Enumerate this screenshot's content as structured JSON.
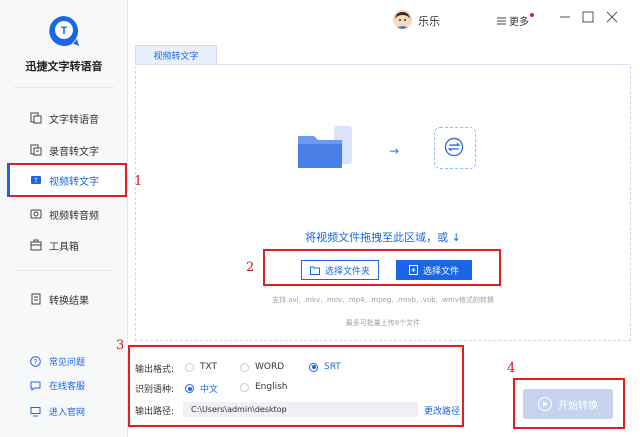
{
  "app": {
    "name": "迅捷文字转语音",
    "logo_letter": "T"
  },
  "sidebar": {
    "items": [
      {
        "label": "文字转语音",
        "icon": "text-to-speech-icon"
      },
      {
        "label": "录音转文字",
        "icon": "recording-to-text-icon"
      },
      {
        "label": "视频转文字",
        "icon": "video-to-text-icon",
        "active": true
      },
      {
        "label": "视频转音频",
        "icon": "video-to-audio-icon"
      },
      {
        "label": "工具箱",
        "icon": "toolbox-icon"
      },
      {
        "label": "转换结果",
        "icon": "results-icon"
      }
    ],
    "bottom_links": [
      {
        "label": "常见问题",
        "icon": "question-icon"
      },
      {
        "label": "在线客服",
        "icon": "chat-icon"
      },
      {
        "label": "进入官网",
        "icon": "monitor-icon"
      }
    ]
  },
  "header": {
    "user_name": "乐乐",
    "more_label": "更多"
  },
  "tab": {
    "label": "视频转文字"
  },
  "drop_area": {
    "hint": "将视频文件拖拽至此区域，或 ↓",
    "select_folder_label": "选择文件夹",
    "select_file_label": "选择文件",
    "supported_formats": "支持.avi, .mkv, .mov, .mp4, .mpeg, .rmvb, .vob, .wmv格式的转换",
    "max_files": "最多可批量上传8个文件"
  },
  "options": {
    "output_format_label": "输出格式:",
    "formats": [
      {
        "label": "TXT",
        "selected": false
      },
      {
        "label": "WORD",
        "selected": false
      },
      {
        "label": "SRT",
        "selected": true
      }
    ],
    "language_label": "识别语种:",
    "languages": [
      {
        "label": "中文",
        "selected": true
      },
      {
        "label": "English",
        "selected": false
      }
    ],
    "output_path_label": "输出路径:",
    "output_path_value": "C:\\Users\\admin\\desktop",
    "change_path_label": "更改路径"
  },
  "start_button_label": "开始转换",
  "annotations": [
    "1",
    "2",
    "3",
    "4"
  ],
  "colors": {
    "accent": "#1a66e6",
    "annotation_red": "#e02020",
    "disabled_button": "#c5d3ee"
  }
}
